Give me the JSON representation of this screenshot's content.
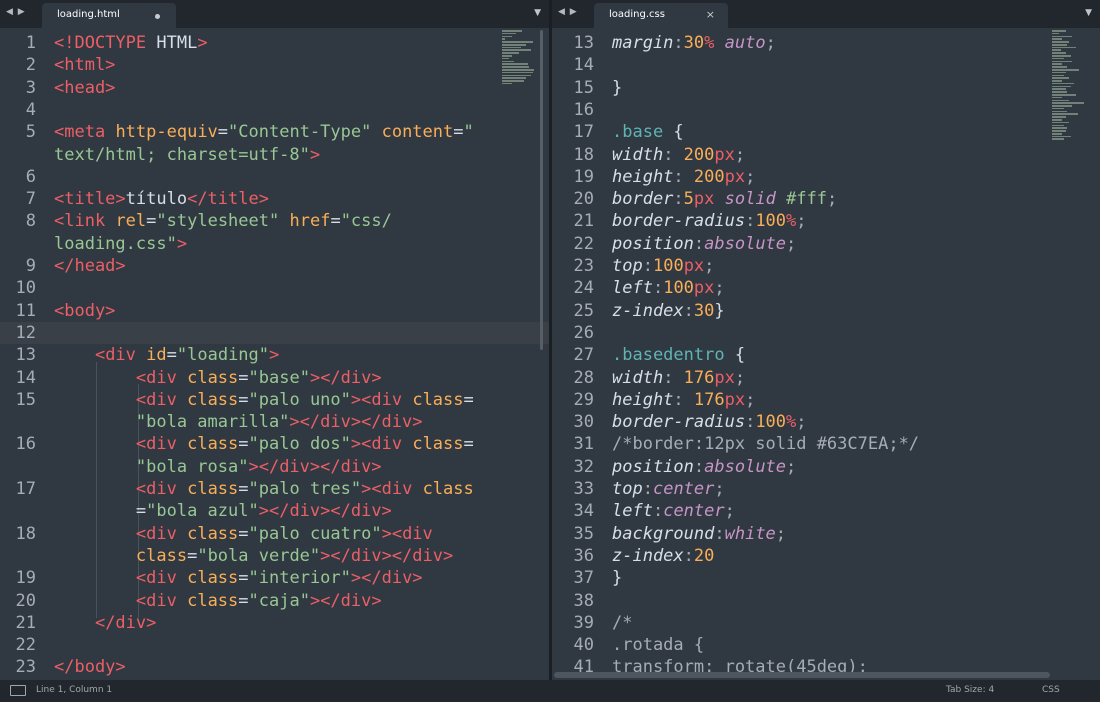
{
  "left_tab": {
    "arrows": "◀ ▶",
    "name": "loading.html",
    "menu": "▼"
  },
  "right_tab": {
    "arrows": "◀ ▶",
    "name": "loading.css",
    "close": "×",
    "menu": "▼"
  },
  "left_lines": [
    {
      "n": "1",
      "parts": [
        [
          "t-tag",
          "<!DOCTYPE"
        ],
        [
          "t-plain",
          " HTML"
        ],
        [
          "t-tag",
          ">"
        ]
      ]
    },
    {
      "n": "2",
      "parts": [
        [
          "t-tag",
          "<html>"
        ]
      ]
    },
    {
      "n": "3",
      "parts": [
        [
          "t-tag",
          "<head>"
        ]
      ]
    },
    {
      "n": "4",
      "parts": []
    },
    {
      "n": "5",
      "parts": [
        [
          "t-tag",
          "<meta"
        ],
        [
          "t-plain",
          " "
        ],
        [
          "t-attr",
          "http-equiv"
        ],
        [
          "t-plain",
          "="
        ],
        [
          "t-str",
          "\"Content-Type\""
        ],
        [
          "t-plain",
          " "
        ],
        [
          "t-attr",
          "content"
        ],
        [
          "t-plain",
          "="
        ],
        [
          "t-str",
          "\""
        ]
      ]
    },
    {
      "n": "",
      "parts": [
        [
          "t-str",
          "text/html; charset=utf-8\""
        ],
        [
          "t-tag",
          ">"
        ]
      ]
    },
    {
      "n": "6",
      "parts": []
    },
    {
      "n": "7",
      "parts": [
        [
          "t-tag",
          "<title>"
        ],
        [
          "t-plain",
          "título"
        ],
        [
          "t-tag",
          "</title>"
        ]
      ]
    },
    {
      "n": "8",
      "parts": [
        [
          "t-tag",
          "<link"
        ],
        [
          "t-plain",
          " "
        ],
        [
          "t-attr",
          "rel"
        ],
        [
          "t-plain",
          "="
        ],
        [
          "t-str",
          "\"stylesheet\""
        ],
        [
          "t-plain",
          " "
        ],
        [
          "t-attr",
          "href"
        ],
        [
          "t-plain",
          "="
        ],
        [
          "t-str",
          "\"css/"
        ]
      ]
    },
    {
      "n": "",
      "parts": [
        [
          "t-str",
          "loading.css\""
        ],
        [
          "t-tag",
          ">"
        ]
      ]
    },
    {
      "n": "9",
      "parts": [
        [
          "t-tag",
          "</head>"
        ]
      ]
    },
    {
      "n": "10",
      "parts": []
    },
    {
      "n": "11",
      "parts": [
        [
          "t-tag",
          "<body>"
        ]
      ]
    },
    {
      "n": "12",
      "parts": [],
      "hl": true
    },
    {
      "n": "13",
      "parts": [
        [
          "t-plain",
          "    "
        ],
        [
          "t-tag",
          "<div"
        ],
        [
          "t-plain",
          " "
        ],
        [
          "t-attr",
          "id"
        ],
        [
          "t-plain",
          "="
        ],
        [
          "t-str",
          "\"loading\""
        ],
        [
          "t-tag",
          ">"
        ]
      ]
    },
    {
      "n": "14",
      "parts": [
        [
          "t-plain",
          "        "
        ],
        [
          "t-tag",
          "<div"
        ],
        [
          "t-plain",
          " "
        ],
        [
          "t-attr",
          "class"
        ],
        [
          "t-plain",
          "="
        ],
        [
          "t-str",
          "\"base\""
        ],
        [
          "t-tag",
          "></div>"
        ]
      ]
    },
    {
      "n": "15",
      "parts": [
        [
          "t-plain",
          "        "
        ],
        [
          "t-tag",
          "<div"
        ],
        [
          "t-plain",
          " "
        ],
        [
          "t-attr",
          "class"
        ],
        [
          "t-plain",
          "="
        ],
        [
          "t-str",
          "\"palo uno\""
        ],
        [
          "t-tag",
          "><div"
        ],
        [
          "t-plain",
          " "
        ],
        [
          "t-attr",
          "class"
        ],
        [
          "t-plain",
          "="
        ]
      ]
    },
    {
      "n": "",
      "parts": [
        [
          "t-plain",
          "        "
        ],
        [
          "t-str",
          "\"bola amarilla\""
        ],
        [
          "t-tag",
          "></div></div>"
        ]
      ]
    },
    {
      "n": "16",
      "parts": [
        [
          "t-plain",
          "        "
        ],
        [
          "t-tag",
          "<div"
        ],
        [
          "t-plain",
          " "
        ],
        [
          "t-attr",
          "class"
        ],
        [
          "t-plain",
          "="
        ],
        [
          "t-str",
          "\"palo dos\""
        ],
        [
          "t-tag",
          "><div"
        ],
        [
          "t-plain",
          " "
        ],
        [
          "t-attr",
          "class"
        ],
        [
          "t-plain",
          "="
        ]
      ]
    },
    {
      "n": "",
      "parts": [
        [
          "t-plain",
          "        "
        ],
        [
          "t-str",
          "\"bola rosa\""
        ],
        [
          "t-tag",
          "></div></div>"
        ]
      ]
    },
    {
      "n": "17",
      "parts": [
        [
          "t-plain",
          "        "
        ],
        [
          "t-tag",
          "<div"
        ],
        [
          "t-plain",
          " "
        ],
        [
          "t-attr",
          "class"
        ],
        [
          "t-plain",
          "="
        ],
        [
          "t-str",
          "\"palo tres\""
        ],
        [
          "t-tag",
          "><div"
        ],
        [
          "t-plain",
          " "
        ],
        [
          "t-attr",
          "class"
        ]
      ]
    },
    {
      "n": "",
      "parts": [
        [
          "t-plain",
          "        "
        ],
        [
          "t-plain",
          "="
        ],
        [
          "t-str",
          "\"bola azul\""
        ],
        [
          "t-tag",
          "></div></div>"
        ]
      ]
    },
    {
      "n": "18",
      "parts": [
        [
          "t-plain",
          "        "
        ],
        [
          "t-tag",
          "<div"
        ],
        [
          "t-plain",
          " "
        ],
        [
          "t-attr",
          "class"
        ],
        [
          "t-plain",
          "="
        ],
        [
          "t-str",
          "\"palo cuatro\""
        ],
        [
          "t-tag",
          "><div"
        ]
      ]
    },
    {
      "n": "",
      "parts": [
        [
          "t-plain",
          "        "
        ],
        [
          "t-attr",
          "class"
        ],
        [
          "t-plain",
          "="
        ],
        [
          "t-str",
          "\"bola verde\""
        ],
        [
          "t-tag",
          "></div></div>"
        ]
      ]
    },
    {
      "n": "19",
      "parts": [
        [
          "t-plain",
          "        "
        ],
        [
          "t-tag",
          "<div"
        ],
        [
          "t-plain",
          " "
        ],
        [
          "t-attr",
          "class"
        ],
        [
          "t-plain",
          "="
        ],
        [
          "t-str",
          "\"interior\""
        ],
        [
          "t-tag",
          "></div>"
        ]
      ]
    },
    {
      "n": "20",
      "parts": [
        [
          "t-plain",
          "        "
        ],
        [
          "t-tag",
          "<div"
        ],
        [
          "t-plain",
          " "
        ],
        [
          "t-attr",
          "class"
        ],
        [
          "t-plain",
          "="
        ],
        [
          "t-str",
          "\"caja\""
        ],
        [
          "t-tag",
          "></div>"
        ]
      ]
    },
    {
      "n": "21",
      "parts": [
        [
          "t-plain",
          "    "
        ],
        [
          "t-tag",
          "</div>"
        ]
      ]
    },
    {
      "n": "22",
      "parts": []
    },
    {
      "n": "23",
      "parts": [
        [
          "t-tag",
          "</body>"
        ]
      ]
    }
  ],
  "right_lines": [
    {
      "n": "13",
      "parts": [
        [
          "t-prop",
          "margin"
        ],
        [
          "t-punc",
          ":"
        ],
        [
          "t-num",
          "30"
        ],
        [
          "t-unit",
          "%"
        ],
        [
          "t-plain",
          " "
        ],
        [
          "t-val",
          "auto"
        ],
        [
          "t-punc",
          ";"
        ]
      ]
    },
    {
      "n": "14",
      "parts": []
    },
    {
      "n": "15",
      "parts": [
        [
          "t-plain",
          "}"
        ]
      ]
    },
    {
      "n": "16",
      "parts": []
    },
    {
      "n": "17",
      "parts": [
        [
          "t-cls",
          ".base"
        ],
        [
          "t-plain",
          " {"
        ]
      ]
    },
    {
      "n": "18",
      "parts": [
        [
          "t-prop",
          "width"
        ],
        [
          "t-punc",
          ": "
        ],
        [
          "t-num",
          "200"
        ],
        [
          "t-unit",
          "px"
        ],
        [
          "t-punc",
          ";"
        ]
      ]
    },
    {
      "n": "19",
      "parts": [
        [
          "t-prop",
          "height"
        ],
        [
          "t-punc",
          ": "
        ],
        [
          "t-num",
          "200"
        ],
        [
          "t-unit",
          "px"
        ],
        [
          "t-punc",
          ";"
        ]
      ]
    },
    {
      "n": "20",
      "parts": [
        [
          "t-prop",
          "border"
        ],
        [
          "t-punc",
          ":"
        ],
        [
          "t-num",
          "5"
        ],
        [
          "t-unit",
          "px"
        ],
        [
          "t-plain",
          " "
        ],
        [
          "t-val",
          "solid"
        ],
        [
          "t-plain",
          " "
        ],
        [
          "t-str",
          "#fff"
        ],
        [
          "t-punc",
          ";"
        ]
      ]
    },
    {
      "n": "21",
      "parts": [
        [
          "t-prop",
          "border-radius"
        ],
        [
          "t-punc",
          ":"
        ],
        [
          "t-num",
          "100"
        ],
        [
          "t-unit",
          "%"
        ],
        [
          "t-punc",
          ";"
        ]
      ]
    },
    {
      "n": "22",
      "parts": [
        [
          "t-prop",
          "position"
        ],
        [
          "t-punc",
          ":"
        ],
        [
          "t-val",
          "absolute"
        ],
        [
          "t-punc",
          ";"
        ]
      ]
    },
    {
      "n": "23",
      "parts": [
        [
          "t-prop",
          "top"
        ],
        [
          "t-punc",
          ":"
        ],
        [
          "t-num",
          "100"
        ],
        [
          "t-unit",
          "px"
        ],
        [
          "t-punc",
          ";"
        ]
      ]
    },
    {
      "n": "24",
      "parts": [
        [
          "t-prop",
          "left"
        ],
        [
          "t-punc",
          ":"
        ],
        [
          "t-num",
          "100"
        ],
        [
          "t-unit",
          "px"
        ],
        [
          "t-punc",
          ";"
        ]
      ]
    },
    {
      "n": "25",
      "parts": [
        [
          "t-prop",
          "z-index"
        ],
        [
          "t-punc",
          ":"
        ],
        [
          "t-num",
          "30"
        ],
        [
          "t-plain",
          "}"
        ]
      ]
    },
    {
      "n": "26",
      "parts": []
    },
    {
      "n": "27",
      "parts": [
        [
          "t-cls",
          ".basedentro"
        ],
        [
          "t-plain",
          " {"
        ]
      ]
    },
    {
      "n": "28",
      "parts": [
        [
          "t-prop",
          "width"
        ],
        [
          "t-punc",
          ": "
        ],
        [
          "t-num",
          "176"
        ],
        [
          "t-unit",
          "px"
        ],
        [
          "t-punc",
          ";"
        ]
      ]
    },
    {
      "n": "29",
      "parts": [
        [
          "t-prop",
          "height"
        ],
        [
          "t-punc",
          ": "
        ],
        [
          "t-num",
          "176"
        ],
        [
          "t-unit",
          "px"
        ],
        [
          "t-punc",
          ";"
        ]
      ]
    },
    {
      "n": "30",
      "parts": [
        [
          "t-prop",
          "border-radius"
        ],
        [
          "t-punc",
          ":"
        ],
        [
          "t-num",
          "100"
        ],
        [
          "t-unit",
          "%"
        ],
        [
          "t-punc",
          ";"
        ]
      ]
    },
    {
      "n": "31",
      "parts": [
        [
          "t-com",
          "/*border:12px solid #63C7EA;*/"
        ]
      ]
    },
    {
      "n": "32",
      "parts": [
        [
          "t-prop",
          "position"
        ],
        [
          "t-punc",
          ":"
        ],
        [
          "t-val",
          "absolute"
        ],
        [
          "t-punc",
          ";"
        ]
      ]
    },
    {
      "n": "33",
      "parts": [
        [
          "t-prop",
          "top"
        ],
        [
          "t-punc",
          ":"
        ],
        [
          "t-val",
          "center"
        ],
        [
          "t-punc",
          ";"
        ]
      ]
    },
    {
      "n": "34",
      "parts": [
        [
          "t-prop",
          "left"
        ],
        [
          "t-punc",
          ":"
        ],
        [
          "t-val",
          "center"
        ],
        [
          "t-punc",
          ";"
        ]
      ]
    },
    {
      "n": "35",
      "parts": [
        [
          "t-prop",
          "background"
        ],
        [
          "t-punc",
          ":"
        ],
        [
          "t-val",
          "white"
        ],
        [
          "t-punc",
          ";"
        ]
      ]
    },
    {
      "n": "36",
      "parts": [
        [
          "t-prop",
          "z-index"
        ],
        [
          "t-punc",
          ":"
        ],
        [
          "t-num",
          "20"
        ]
      ]
    },
    {
      "n": "37",
      "parts": [
        [
          "t-plain",
          "}"
        ]
      ]
    },
    {
      "n": "38",
      "parts": []
    },
    {
      "n": "39",
      "parts": [
        [
          "t-com",
          "/*"
        ]
      ]
    },
    {
      "n": "40",
      "parts": [
        [
          "t-com",
          ".rotada {"
        ]
      ]
    },
    {
      "n": "41",
      "parts": [
        [
          "t-com",
          "transform: rotate(45deg);"
        ]
      ]
    }
  ],
  "status": {
    "position": "Line 1, Column 1",
    "tab_size": "Tab Size: 4",
    "syntax": "CSS"
  }
}
